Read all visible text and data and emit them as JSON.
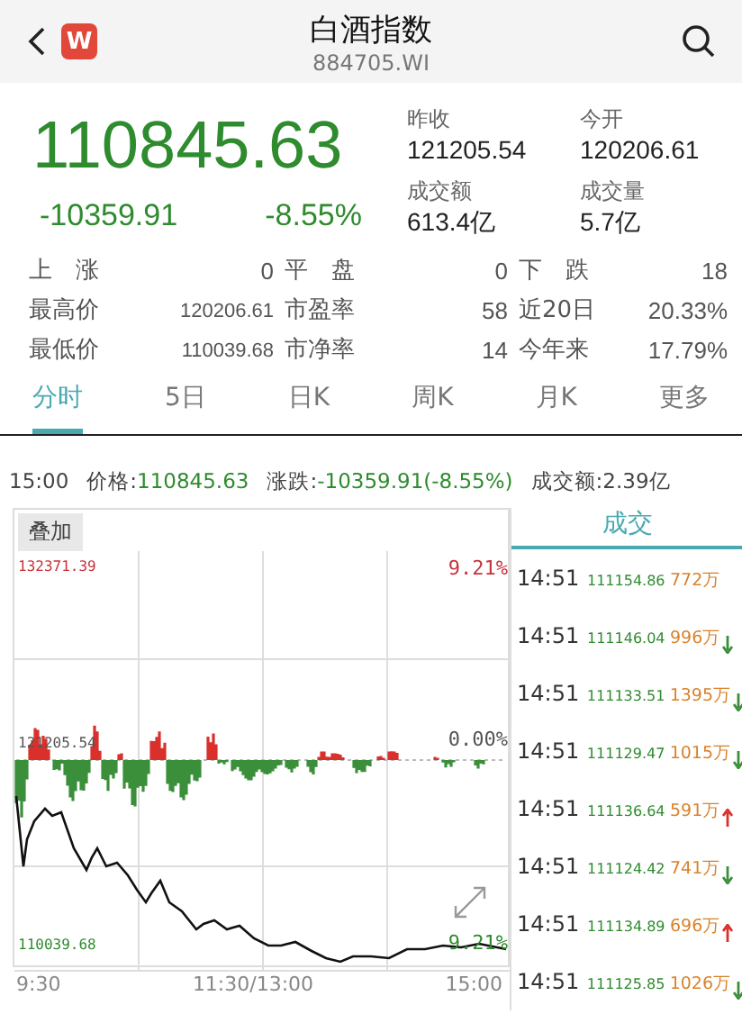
{
  "header": {
    "logo": "W",
    "title": "白酒指数",
    "code": "884705.WI"
  },
  "quote": {
    "price": "110845.63",
    "change": "-10359.91",
    "change_pct": "-8.55%",
    "fields": [
      {
        "label": "昨收",
        "value": "121205.54"
      },
      {
        "label": "今开",
        "value": "120206.61"
      },
      {
        "label": "成交额",
        "value": "613.4亿"
      },
      {
        "label": "成交量",
        "value": "5.7亿"
      }
    ]
  },
  "stats": [
    [
      {
        "label": "上　涨",
        "value": "0"
      },
      {
        "label": "平　盘",
        "value": "0"
      },
      {
        "label": "下　跌",
        "value": "18"
      }
    ],
    [
      {
        "label": "最高价",
        "value": "120206.61"
      },
      {
        "label": "市盈率",
        "value": "58"
      },
      {
        "label": "近20日",
        "value": "20.33%"
      }
    ],
    [
      {
        "label": "最低价",
        "value": "110039.68"
      },
      {
        "label": "市净率",
        "value": "14"
      },
      {
        "label": "今年来",
        "value": "17.79%"
      }
    ]
  ],
  "tabs": [
    {
      "label": "分时",
      "selected": true
    },
    {
      "label": "5日",
      "selected": false
    },
    {
      "label": "日K",
      "selected": false
    },
    {
      "label": "周K",
      "selected": false
    },
    {
      "label": "月K",
      "selected": false
    },
    {
      "label": "更多",
      "selected": false
    }
  ],
  "info": {
    "time": "15:00",
    "price_label": "价格:",
    "price": "110845.63",
    "change_label": "涨跌:",
    "change": "-10359.91(-8.55%)",
    "amount": "成交额:2.39亿"
  },
  "chart": {
    "overlay_button": "叠加",
    "max_price": "132371.39",
    "max_pct": "9.21%",
    "mid_price": "121205.54",
    "mid_pct": "0.00%",
    "min_price": "110039.68",
    "min_pct": "9.21%",
    "times": [
      "9:30",
      "11:30/13:00",
      "15:00"
    ]
  },
  "trades": {
    "title": "成交",
    "rows": [
      {
        "time": "14:51",
        "price": "111154.86",
        "volume": "772万",
        "kind": "flat"
      },
      {
        "time": "14:51",
        "price": "111146.04",
        "volume": "996万",
        "kind": "down"
      },
      {
        "time": "14:51",
        "price": "111133.51",
        "volume": "1395万",
        "kind": "down"
      },
      {
        "time": "14:51",
        "price": "111129.47",
        "volume": "1015万",
        "kind": "down"
      },
      {
        "time": "14:51",
        "price": "111136.64",
        "volume": "591万",
        "kind": "up"
      },
      {
        "time": "14:51",
        "price": "111124.42",
        "volume": "741万",
        "kind": "down"
      },
      {
        "time": "14:51",
        "price": "111134.89",
        "volume": "696万",
        "kind": "up"
      },
      {
        "time": "14:51",
        "price": "111125.85",
        "volume": "1026万",
        "kind": "down"
      }
    ]
  }
}
